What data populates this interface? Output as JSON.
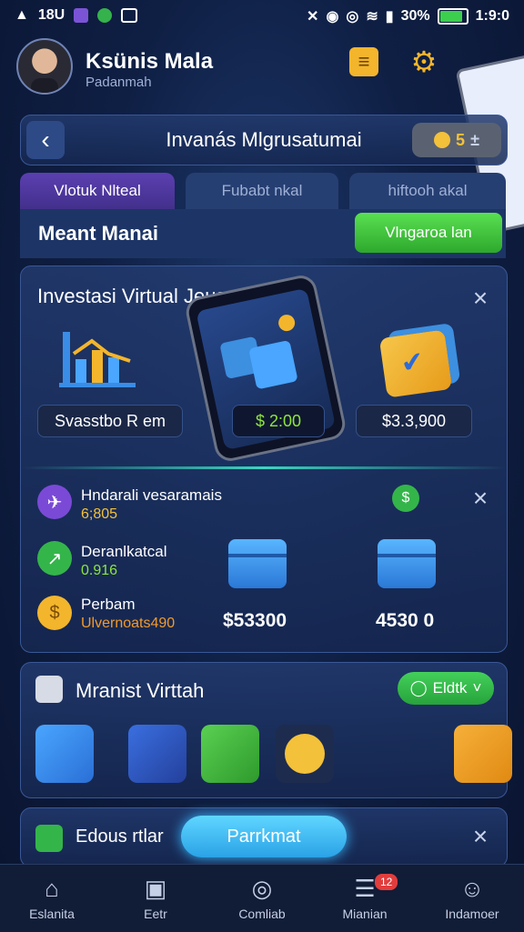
{
  "status_bar": {
    "time_left": "18U",
    "battery": "30%",
    "time": "1:9:0"
  },
  "profile": {
    "name": "Ksünis Mala",
    "subtitle": "Padanmah"
  },
  "header": {
    "title": "Invanás Mlgrusatumai",
    "coin_count": "5"
  },
  "tabs": [
    {
      "label": "Vlotuk Nlteal",
      "active": true
    },
    {
      "label": "Fubabt nkal",
      "active": false
    },
    {
      "label": "hiftooh akal",
      "active": false
    }
  ],
  "sub": {
    "title": "Meant Manai",
    "action": "Vlngaroa lan"
  },
  "investment_card": {
    "title": "Investasi Virtual Jeus",
    "left_pill": "Svasstbo R em",
    "phone_value": "$ 2:00",
    "right_pill": "$3.3,900",
    "rows": [
      {
        "title": "Hndarali vesaramais",
        "value": "6;805",
        "value_color": "#f3c13a"
      },
      {
        "title": "Deranlkatcal",
        "value": "0.916",
        "value_color": "#8ee53d"
      },
      {
        "title": "Perbam",
        "value": "Ulvernoats490",
        "value_color": "#f39a2a"
      }
    ],
    "amounts": [
      "$53300",
      "4530 0"
    ]
  },
  "section": {
    "title": "Mranist Virttah",
    "button": "Eldtk"
  },
  "promo": {
    "text": "Edous rtlar",
    "button": "Parrkmat"
  },
  "nav": [
    {
      "label": "Eslanita",
      "icon": "home-icon"
    },
    {
      "label": "Eetr",
      "icon": "wallet-icon"
    },
    {
      "label": "Comliab",
      "icon": "circle-icon"
    },
    {
      "label": "Mianian",
      "icon": "inbox-icon",
      "badge": "12"
    },
    {
      "label": "Indamoer",
      "icon": "user-icon"
    }
  ]
}
